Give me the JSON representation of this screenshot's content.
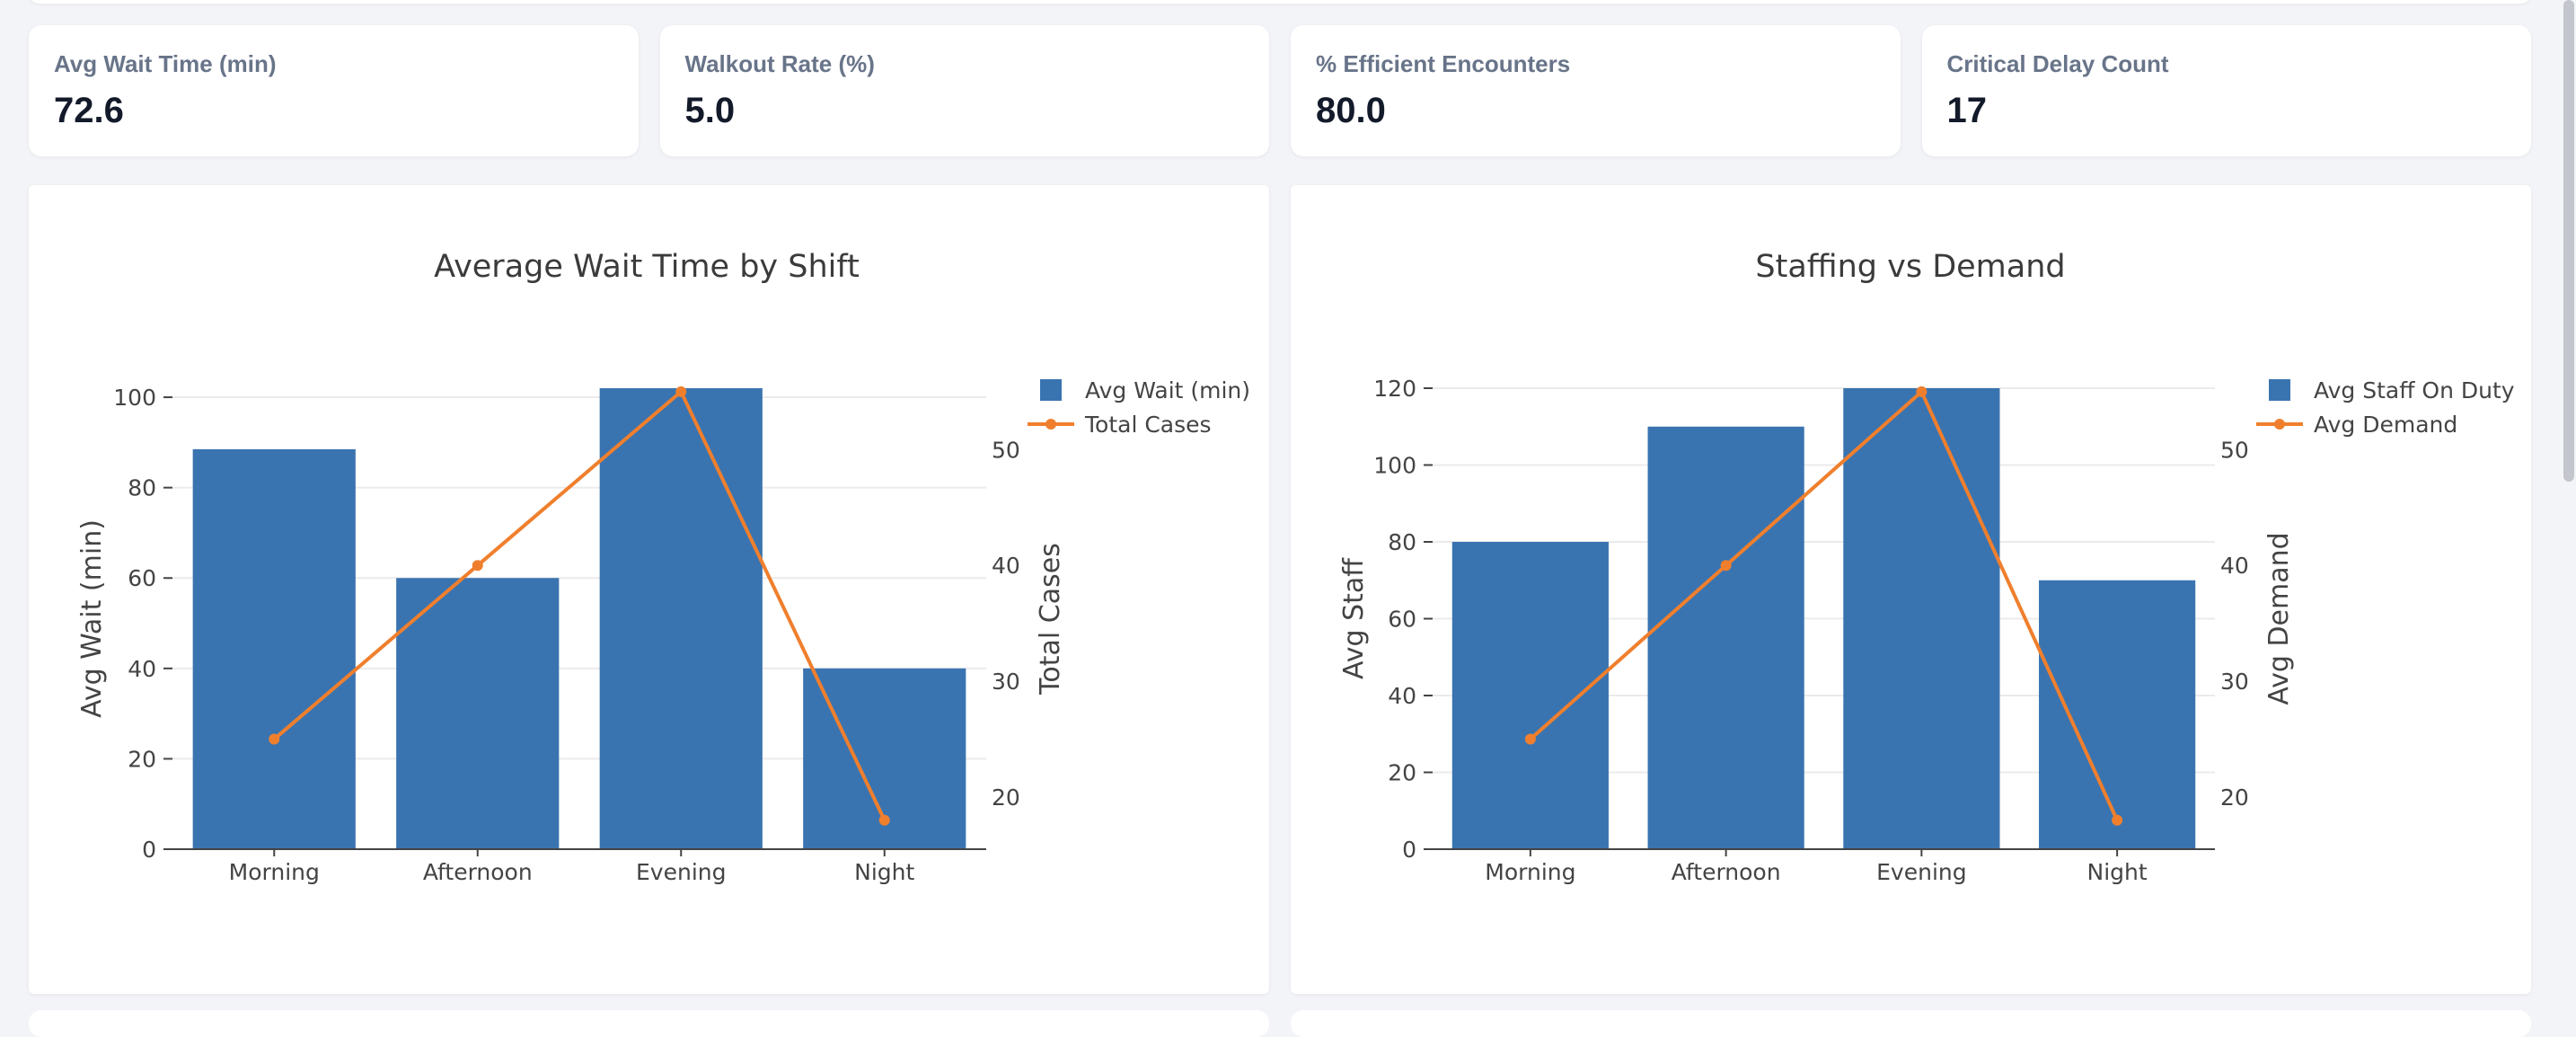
{
  "kpis": [
    {
      "label": "Avg Wait Time (min)",
      "value": "72.6"
    },
    {
      "label": "Walkout Rate (%)",
      "value": "5.0"
    },
    {
      "label": "% Efficient Encounters",
      "value": "80.0"
    },
    {
      "label": "Critical Delay Count",
      "value": "17"
    }
  ],
  "colors": {
    "bar": "#3a74b0",
    "line": "#f07f2d",
    "grid": "#ebebeb"
  },
  "chart_data": [
    {
      "type": "bar",
      "title": "Average Wait Time by Shift",
      "categories": [
        "Morning",
        "Afternoon",
        "Evening",
        "Night"
      ],
      "series": [
        {
          "name": "Avg Wait (min)",
          "kind": "bar",
          "axis": "y",
          "values": [
            88.5,
            60,
            102,
            40
          ]
        },
        {
          "name": "Total Cases",
          "kind": "line",
          "axis": "y2",
          "values": [
            25,
            40,
            55,
            18
          ]
        }
      ],
      "ylabel": "Avg Wait (min)",
      "y2label": "Total Cases",
      "ylim": [
        0,
        102
      ],
      "y2lim": [
        15.5,
        55.3
      ],
      "yticks": [
        0,
        20,
        40,
        60,
        80,
        100
      ],
      "y2ticks": [
        20,
        30,
        40,
        50
      ],
      "grid": true,
      "legend_position": "top-right"
    },
    {
      "type": "bar",
      "title": "Staffing vs Demand",
      "categories": [
        "Morning",
        "Afternoon",
        "Evening",
        "Night"
      ],
      "series": [
        {
          "name": "Avg Staff On Duty",
          "kind": "bar",
          "axis": "y",
          "values": [
            80,
            110,
            120,
            70
          ]
        },
        {
          "name": "Avg Demand",
          "kind": "line",
          "axis": "y2",
          "values": [
            25,
            40,
            55,
            18
          ]
        }
      ],
      "ylabel": "Avg Staff",
      "y2label": "Avg Demand",
      "ylim": [
        0,
        120
      ],
      "y2lim": [
        15.5,
        55.3
      ],
      "yticks": [
        0,
        20,
        40,
        60,
        80,
        100,
        120
      ],
      "y2ticks": [
        20,
        30,
        40,
        50
      ],
      "grid": true,
      "legend_position": "top-right"
    }
  ]
}
